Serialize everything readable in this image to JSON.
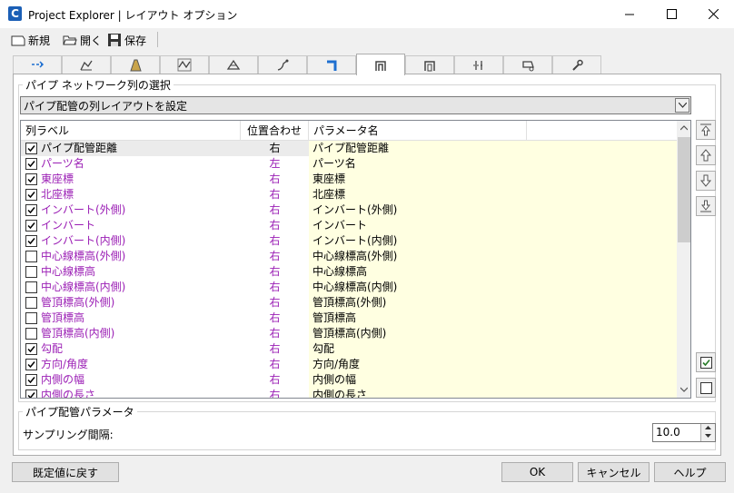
{
  "window": {
    "app_icon_letter": "C",
    "title": "Project Explorer | レイアウト オプション"
  },
  "toolbar": {
    "new_label": "新規",
    "open_label": "開く",
    "save_label": "保存"
  },
  "tabs": [
    {
      "icon": "alignment-icon",
      "active": false
    },
    {
      "icon": "profile-icon",
      "active": false
    },
    {
      "icon": "corridor-icon",
      "active": false
    },
    {
      "icon": "feature-line-icon",
      "active": false
    },
    {
      "icon": "surface-icon",
      "active": false
    },
    {
      "icon": "point-icon",
      "active": false
    },
    {
      "icon": "pipe-network-icon",
      "active": false
    },
    {
      "icon": "pipe-icon",
      "active": true
    },
    {
      "icon": "structure-icon",
      "active": false
    },
    {
      "icon": "station-icon",
      "active": false
    },
    {
      "icon": "parcel-icon",
      "active": false
    },
    {
      "icon": "wrench-icon",
      "active": false
    }
  ],
  "column_group": {
    "title": "パイプ ネットワーク列の選択",
    "selector_value": "パイプ配管の列レイアウトを設定"
  },
  "grid": {
    "headers": {
      "label": "列ラベル",
      "align": "位置合わせ",
      "param": "パラメータ名"
    },
    "label_color": "#9b1fb5",
    "rows": [
      {
        "checked": true,
        "label": "パイプ配管距離",
        "align": "右",
        "param": "パイプ配管距離",
        "selected": true
      },
      {
        "checked": true,
        "label": "パーツ名",
        "align": "左",
        "param": "パーツ名"
      },
      {
        "checked": true,
        "label": "東座標",
        "align": "右",
        "param": "東座標"
      },
      {
        "checked": true,
        "label": "北座標",
        "align": "右",
        "param": "北座標"
      },
      {
        "checked": true,
        "label": "インバート(外側)",
        "align": "右",
        "param": "インバート(外側)"
      },
      {
        "checked": true,
        "label": "インバート",
        "align": "右",
        "param": "インバート"
      },
      {
        "checked": true,
        "label": "インバート(内側)",
        "align": "右",
        "param": "インバート(内側)"
      },
      {
        "checked": false,
        "label": "中心線標高(外側)",
        "align": "右",
        "param": "中心線標高(外側)"
      },
      {
        "checked": false,
        "label": "中心線標高",
        "align": "右",
        "param": "中心線標高"
      },
      {
        "checked": false,
        "label": "中心線標高(内側)",
        "align": "右",
        "param": "中心線標高(内側)"
      },
      {
        "checked": false,
        "label": "管頂標高(外側)",
        "align": "右",
        "param": "管頂標高(外側)"
      },
      {
        "checked": false,
        "label": "管頂標高",
        "align": "右",
        "param": "管頂標高"
      },
      {
        "checked": false,
        "label": "管頂標高(内側)",
        "align": "右",
        "param": "管頂標高(内側)"
      },
      {
        "checked": true,
        "label": "勾配",
        "align": "右",
        "param": "勾配"
      },
      {
        "checked": true,
        "label": "方向/角度",
        "align": "右",
        "param": "方向/角度"
      },
      {
        "checked": true,
        "label": "内側の幅",
        "align": "右",
        "param": "内側の幅"
      },
      {
        "checked": true,
        "label": "内側の長さ",
        "align": "右",
        "param": "内側の長さ"
      }
    ]
  },
  "side_buttons": [
    {
      "name": "move-to-top-button",
      "icon": "arrow-top-icon"
    },
    {
      "name": "move-up-button",
      "icon": "arrow-up-icon"
    },
    {
      "name": "move-down-button",
      "icon": "arrow-down-icon"
    },
    {
      "name": "move-to-bottom-button",
      "icon": "arrow-bottom-icon"
    }
  ],
  "param_group": {
    "title": "パイプ配管パラメータ",
    "sampling_label": "サンプリング間隔:",
    "sampling_value": "10.0"
  },
  "buttons": {
    "reset": "既定値に戻す",
    "ok": "OK",
    "cancel": "キャンセル",
    "help": "ヘルプ"
  }
}
